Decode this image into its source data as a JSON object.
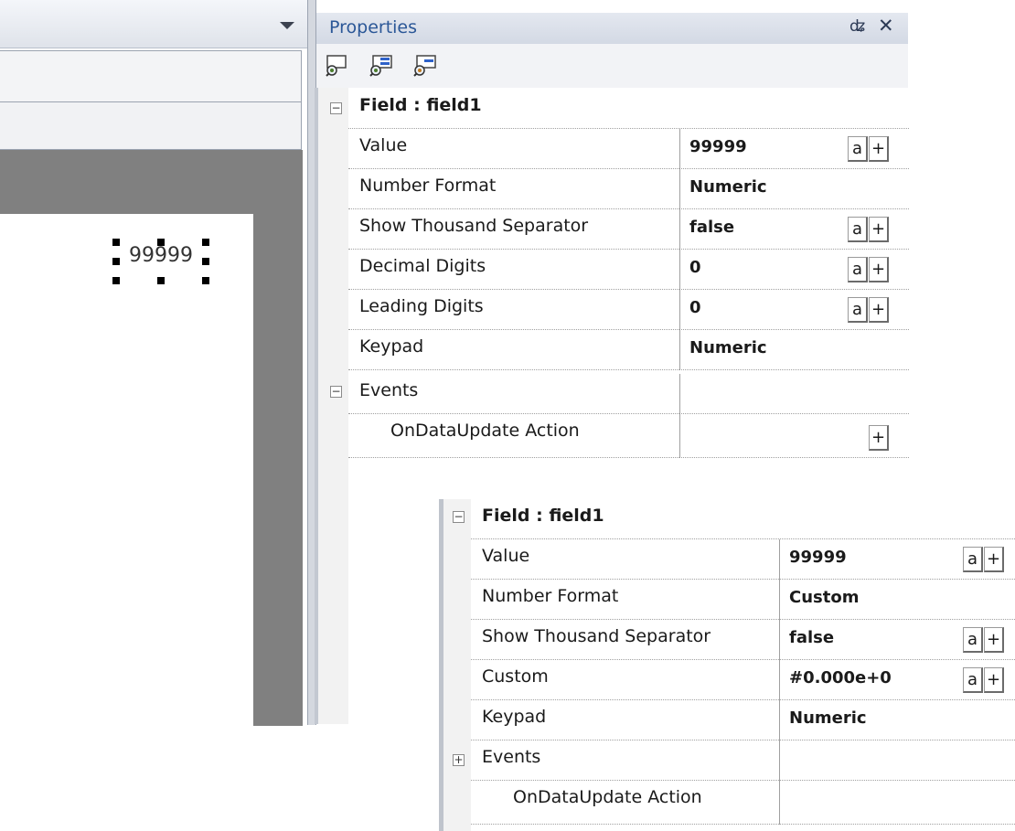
{
  "editor": {
    "field_text": "99999"
  },
  "properties": {
    "title": "Properties",
    "pin_icon": "pin-icon",
    "close_icon": "close-icon",
    "toolbar_icons": [
      "categorized-view-icon",
      "add-property-icon",
      "filter-property-icon"
    ]
  },
  "grid1": {
    "category": "Field : field1",
    "rows": [
      {
        "label": "Value",
        "value": "99999",
        "a": "a",
        "plus": "+"
      },
      {
        "label": "Number Format",
        "value": "Numeric"
      },
      {
        "label": "Show Thousand Separator",
        "value": "false",
        "a": "a",
        "plus": "+"
      },
      {
        "label": "Decimal Digits",
        "value": "0",
        "a": "a",
        "plus": "+"
      },
      {
        "label": "Leading Digits",
        "value": "0",
        "a": "a",
        "plus": "+"
      },
      {
        "label": "Keypad",
        "value": "Numeric"
      }
    ],
    "events_label": "Events",
    "event_row": {
      "label": "OnDataUpdate Action",
      "plus": "+"
    }
  },
  "grid2": {
    "category": "Field : field1",
    "rows": [
      {
        "label": "Value",
        "value": "99999",
        "a": "a",
        "plus": "+"
      },
      {
        "label": "Number Format",
        "value": "Custom"
      },
      {
        "label": "Show Thousand Separator",
        "value": "false",
        "a": "a",
        "plus": "+"
      },
      {
        "label": "Custom",
        "value": "#0.000e+0",
        "a": "a",
        "plus": "+"
      },
      {
        "label": "Keypad",
        "value": "Numeric"
      }
    ],
    "events_label": "Events",
    "event_row": {
      "label": "OnDataUpdate Action"
    }
  }
}
